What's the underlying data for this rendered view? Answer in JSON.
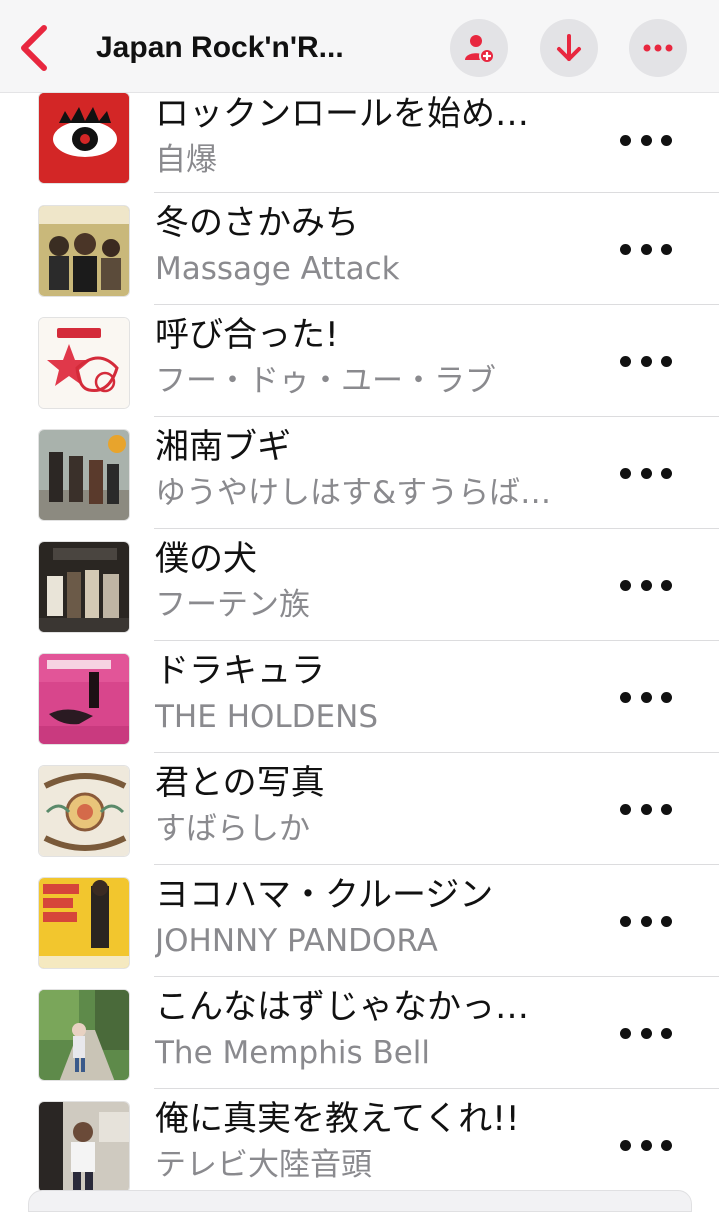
{
  "header": {
    "title": "Japan Rock'n'R...",
    "accent_color": "#e8273f",
    "back_icon": "chevron-left-icon",
    "add_person_icon": "person-add-icon",
    "download_icon": "arrow-down-icon",
    "more_icon": "ellipsis-icon"
  },
  "songs": [
    {
      "title": "ロックンロールを始め…",
      "artist": "自爆",
      "art": "red-eye-art"
    },
    {
      "title": "冬のさかみち",
      "artist": "Massage Attack",
      "art": "band-photo-art"
    },
    {
      "title": "呼び合った!",
      "artist": "フー・ドゥ・ユー・ラブ",
      "art": "who-do-you-love-art"
    },
    {
      "title": "湘南ブギ",
      "artist": "ゆうやけしはす&すうらば…",
      "art": "beach-band-art"
    },
    {
      "title": "僕の犬",
      "artist": "フーテン族",
      "art": "dark-photo-art"
    },
    {
      "title": "ドラキュラ",
      "artist": "THE HOLDENS",
      "art": "pink-cover-art"
    },
    {
      "title": "君との写真",
      "artist": "すばらしか",
      "art": "psychedelic-art"
    },
    {
      "title": "ヨコハマ・クルージン",
      "artist": "JOHNNY PANDORA",
      "art": "dance-cover-art"
    },
    {
      "title": "こんなはずじゃなかっ…",
      "artist": "The Memphis Bell",
      "art": "street-photo-art"
    },
    {
      "title": "俺に真実を教えてくれ!!",
      "artist": "テレビ大陸音頭",
      "art": "room-photo-art"
    }
  ]
}
